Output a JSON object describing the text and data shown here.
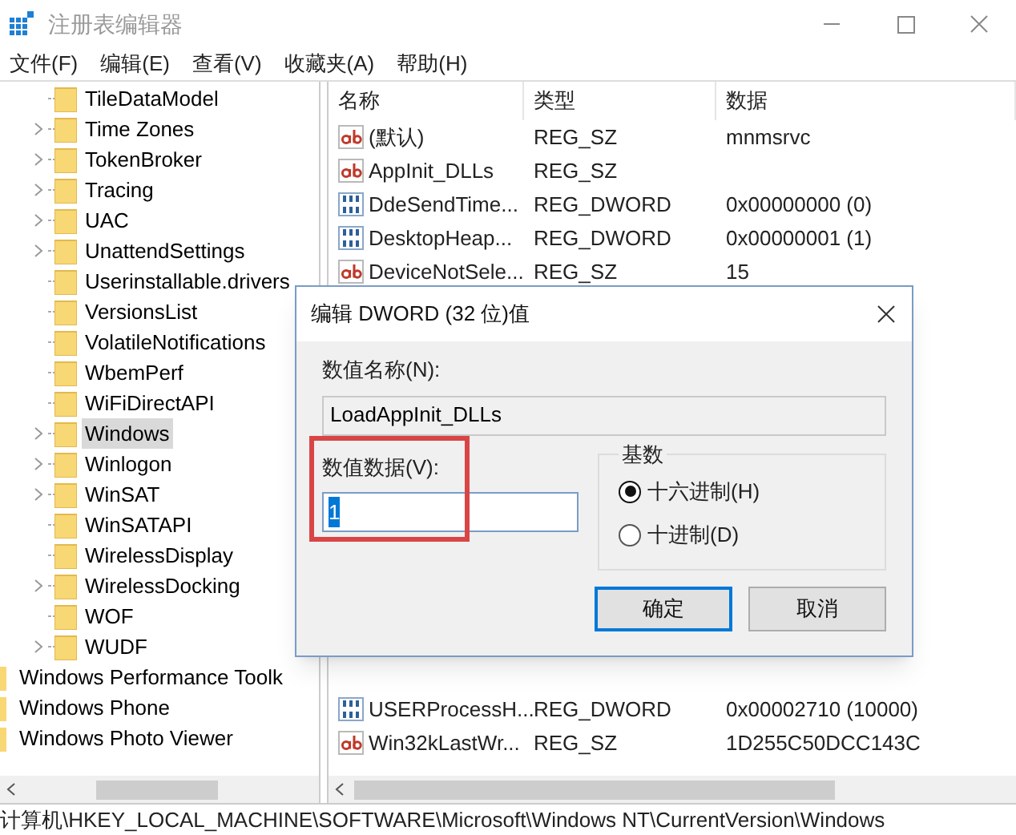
{
  "window": {
    "title": "注册表编辑器"
  },
  "menu": [
    "文件(F)",
    "编辑(E)",
    "查看(V)",
    "收藏夹(A)",
    "帮助(H)"
  ],
  "tree": {
    "items": [
      {
        "label": "TileDataModel",
        "expandable": false,
        "selected": false
      },
      {
        "label": "Time Zones",
        "expandable": true,
        "selected": false
      },
      {
        "label": "TokenBroker",
        "expandable": true,
        "selected": false
      },
      {
        "label": "Tracing",
        "expandable": true,
        "selected": false
      },
      {
        "label": "UAC",
        "expandable": true,
        "selected": false
      },
      {
        "label": "UnattendSettings",
        "expandable": true,
        "selected": false
      },
      {
        "label": "Userinstallable.drivers",
        "expandable": false,
        "selected": false
      },
      {
        "label": "VersionsList",
        "expandable": false,
        "selected": false
      },
      {
        "label": "VolatileNotifications",
        "expandable": false,
        "selected": false
      },
      {
        "label": "WbemPerf",
        "expandable": false,
        "selected": false
      },
      {
        "label": "WiFiDirectAPI",
        "expandable": false,
        "selected": false
      },
      {
        "label": "Windows",
        "expandable": true,
        "selected": true
      },
      {
        "label": "Winlogon",
        "expandable": true,
        "selected": false
      },
      {
        "label": "WinSAT",
        "expandable": true,
        "selected": false
      },
      {
        "label": "WinSATAPI",
        "expandable": false,
        "selected": false
      },
      {
        "label": "WirelessDisplay",
        "expandable": false,
        "selected": false
      },
      {
        "label": "WirelessDocking",
        "expandable": true,
        "selected": false
      },
      {
        "label": "WOF",
        "expandable": false,
        "selected": false
      },
      {
        "label": "WUDF",
        "expandable": true,
        "selected": false
      }
    ],
    "parent_items": [
      {
        "label": "Windows Performance Toolk"
      },
      {
        "label": "Windows Phone"
      },
      {
        "label": "Windows Photo Viewer"
      }
    ]
  },
  "table": {
    "columns": [
      "名称",
      "类型",
      "数据"
    ],
    "rows": [
      {
        "kind": "string",
        "name": "(默认)",
        "type": "REG_SZ",
        "data": "mnmsrvc"
      },
      {
        "kind": "string",
        "name": "AppInit_DLLs",
        "type": "REG_SZ",
        "data": ""
      },
      {
        "kind": "binary",
        "name": "DdeSendTime...",
        "type": "REG_DWORD",
        "data": "0x00000000 (0)"
      },
      {
        "kind": "binary",
        "name": "DesktopHeap...",
        "type": "REG_DWORD",
        "data": "0x00000001 (1)"
      },
      {
        "kind": "string",
        "name": "DeviceNotSele...",
        "type": "REG_SZ",
        "data": "15"
      }
    ],
    "rows_below": [
      {
        "kind": "binary",
        "name": "USERProcessH...",
        "type": "REG_DWORD",
        "data": "0x00002710 (10000)"
      },
      {
        "kind": "string",
        "name": "Win32kLastWr...",
        "type": "REG_SZ",
        "data": "1D255C50DCC143C"
      }
    ]
  },
  "status_bar": "计算机\\HKEY_LOCAL_MACHINE\\SOFTWARE\\Microsoft\\Windows NT\\CurrentVersion\\Windows",
  "dialog": {
    "title": "编辑 DWORD (32 位)值",
    "name_label": "数值名称(N):",
    "name_value": "LoadAppInit_DLLs",
    "data_label": "数值数据(V):",
    "data_value": "1",
    "highlighted": true,
    "base_label": "基数",
    "radios": [
      {
        "label": "十六进制(H)",
        "selected": true
      },
      {
        "label": "十进制(D)",
        "selected": false
      }
    ],
    "buttons": [
      {
        "label": "确定",
        "default": true
      },
      {
        "label": "取消",
        "default": false
      }
    ]
  }
}
